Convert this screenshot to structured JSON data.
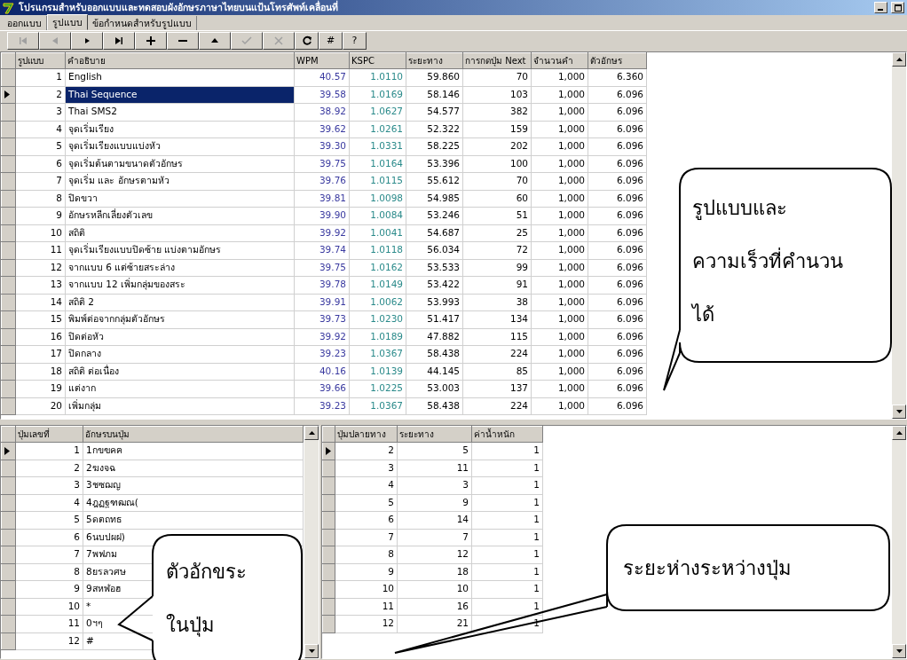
{
  "window": {
    "title": "โปรแกรมสำหรับออกแบบและทดสอบผังอักษรภาษาไทยบนแป้นโทรศัพท์เคลื่อนที่"
  },
  "tabs": [
    {
      "label": "ออกแบบ",
      "selected": false
    },
    {
      "label": "รูปแบบ",
      "selected": true
    },
    {
      "label": "ข้อกำหนดสำหรับรูปแบบ",
      "selected": false
    }
  ],
  "toolbar": [
    {
      "kind": "first",
      "disabled": true
    },
    {
      "kind": "prior",
      "disabled": true
    },
    {
      "kind": "next",
      "disabled": false
    },
    {
      "kind": "last",
      "disabled": false
    },
    {
      "kind": "insert",
      "disabled": false
    },
    {
      "kind": "delete",
      "disabled": false
    },
    {
      "kind": "edit",
      "disabled": false
    },
    {
      "kind": "post",
      "disabled": true
    },
    {
      "kind": "cancel",
      "disabled": true
    },
    {
      "kind": "refresh",
      "disabled": false
    },
    {
      "kind": "text",
      "label": "#",
      "disabled": false
    },
    {
      "kind": "text",
      "label": "?",
      "disabled": false
    }
  ],
  "layouts_table": {
    "columns": [
      "รูปแบบ",
      "คำอธิบาย",
      "WPM",
      "KSPC",
      "ระยะทาง",
      "การกดปุ่ม Next",
      "จำนวนคำ",
      "ตัวอักษร"
    ],
    "rows": [
      {
        "selected": false,
        "cells": [
          "1",
          "English",
          "40.57",
          "1.0110",
          "59.860",
          "70",
          "1,000",
          "6.360"
        ]
      },
      {
        "selected": true,
        "cells": [
          "2",
          "Thai Sequence",
          "39.58",
          "1.0169",
          "58.146",
          "103",
          "1,000",
          "6.096"
        ]
      },
      {
        "selected": false,
        "cells": [
          "3",
          "Thai SMS2",
          "38.92",
          "1.0627",
          "54.577",
          "382",
          "1,000",
          "6.096"
        ]
      },
      {
        "selected": false,
        "cells": [
          "4",
          "จุดเริ่มเรียง",
          "39.62",
          "1.0261",
          "52.322",
          "159",
          "1,000",
          "6.096"
        ]
      },
      {
        "selected": false,
        "cells": [
          "5",
          "จุดเริ่มเรียงแบบแบ่งหัว",
          "39.30",
          "1.0331",
          "58.225",
          "202",
          "1,000",
          "6.096"
        ]
      },
      {
        "selected": false,
        "cells": [
          "6",
          "จุดเริ่มต้นตามขนาดตัวอักษร",
          "39.75",
          "1.0164",
          "53.396",
          "100",
          "1,000",
          "6.096"
        ]
      },
      {
        "selected": false,
        "cells": [
          "7",
          "จุดเริ่ม และ อักษรตามหัว",
          "39.76",
          "1.0115",
          "55.612",
          "70",
          "1,000",
          "6.096"
        ]
      },
      {
        "selected": false,
        "cells": [
          "8",
          "ปิดขวา",
          "39.81",
          "1.0098",
          "54.985",
          "60",
          "1,000",
          "6.096"
        ]
      },
      {
        "selected": false,
        "cells": [
          "9",
          "อักษรหลีกเลี่ยงตัวเลข",
          "39.90",
          "1.0084",
          "53.246",
          "51",
          "1,000",
          "6.096"
        ]
      },
      {
        "selected": false,
        "cells": [
          "10",
          "สถิติ",
          "39.92",
          "1.0041",
          "54.687",
          "25",
          "1,000",
          "6.096"
        ]
      },
      {
        "selected": false,
        "cells": [
          "11",
          "จุดเริ่มเรียงแบบปิดซ้าย แบ่งตามอักษร",
          "39.74",
          "1.0118",
          "56.034",
          "72",
          "1,000",
          "6.096"
        ]
      },
      {
        "selected": false,
        "cells": [
          "12",
          "จากแบบ 6 แต่ซ้ายสระล่าง",
          "39.75",
          "1.0162",
          "53.533",
          "99",
          "1,000",
          "6.096"
        ]
      },
      {
        "selected": false,
        "cells": [
          "13",
          "จากแบบ 12 เพิ่มกลุ่มของสระ",
          "39.78",
          "1.0149",
          "53.422",
          "91",
          "1,000",
          "6.096"
        ]
      },
      {
        "selected": false,
        "cells": [
          "14",
          "สถิติ 2",
          "39.91",
          "1.0062",
          "53.993",
          "38",
          "1,000",
          "6.096"
        ]
      },
      {
        "selected": false,
        "cells": [
          "15",
          "พิมพ์ต่อจากกลุ่มตัวอักษร",
          "39.73",
          "1.0230",
          "51.417",
          "134",
          "1,000",
          "6.096"
        ]
      },
      {
        "selected": false,
        "cells": [
          "16",
          "ปิดต่อหัว",
          "39.92",
          "1.0189",
          "47.882",
          "115",
          "1,000",
          "6.096"
        ]
      },
      {
        "selected": false,
        "cells": [
          "17",
          "ปิดกลาง",
          "39.23",
          "1.0367",
          "58.438",
          "224",
          "1,000",
          "6.096"
        ]
      },
      {
        "selected": false,
        "cells": [
          "18",
          "สถิติ ต่อเนื่อง",
          "40.16",
          "1.0139",
          "44.145",
          "85",
          "1,000",
          "6.096"
        ]
      },
      {
        "selected": false,
        "cells": [
          "19",
          "แต่งาก",
          "39.66",
          "1.0225",
          "53.003",
          "137",
          "1,000",
          "6.096"
        ]
      },
      {
        "selected": false,
        "cells": [
          "20",
          "เพิ่มกลุ่ม",
          "39.23",
          "1.0367",
          "58.438",
          "224",
          "1,000",
          "6.096"
        ]
      }
    ]
  },
  "keys_table": {
    "columns": [
      "ปุ่มเลขที่",
      "อักษรบนปุ่ม"
    ],
    "rows": [
      {
        "selected": true,
        "cells": [
          "1",
          "1กขฃคฅ"
        ]
      },
      {
        "selected": false,
        "cells": [
          "2",
          "2ฆงจฉ"
        ]
      },
      {
        "selected": false,
        "cells": [
          "3",
          "3ชซฌญ"
        ]
      },
      {
        "selected": false,
        "cells": [
          "4",
          "4ฎฏฐฑฒณ("
        ]
      },
      {
        "selected": false,
        "cells": [
          "5",
          "5ดตถทธ"
        ]
      },
      {
        "selected": false,
        "cells": [
          "6",
          "6นบปผฝ)"
        ]
      },
      {
        "selected": false,
        "cells": [
          "7",
          "7พฟภม"
        ]
      },
      {
        "selected": false,
        "cells": [
          "8",
          "8ยรลวศษ"
        ]
      },
      {
        "selected": false,
        "cells": [
          "9",
          "9สหฬอฮ"
        ]
      },
      {
        "selected": false,
        "cells": [
          "10",
          "*"
        ]
      },
      {
        "selected": false,
        "cells": [
          "11",
          "0ฯๆ"
        ]
      },
      {
        "selected": false,
        "cells": [
          "12",
          "#"
        ]
      }
    ]
  },
  "distance_table": {
    "columns": [
      "ปุ่มปลายทาง",
      "ระยะทาง",
      "ค่าน้ำหนัก"
    ],
    "rows": [
      {
        "selected": true,
        "cells": [
          "2",
          "5",
          "1"
        ]
      },
      {
        "selected": false,
        "cells": [
          "3",
          "11",
          "1"
        ]
      },
      {
        "selected": false,
        "cells": [
          "4",
          "3",
          "1"
        ]
      },
      {
        "selected": false,
        "cells": [
          "5",
          "9",
          "1"
        ]
      },
      {
        "selected": false,
        "cells": [
          "6",
          "14",
          "1"
        ]
      },
      {
        "selected": false,
        "cells": [
          "7",
          "7",
          "1"
        ]
      },
      {
        "selected": false,
        "cells": [
          "8",
          "12",
          "1"
        ]
      },
      {
        "selected": false,
        "cells": [
          "9",
          "18",
          "1"
        ]
      },
      {
        "selected": false,
        "cells": [
          "10",
          "10",
          "1"
        ]
      },
      {
        "selected": false,
        "cells": [
          "11",
          "16",
          "1"
        ]
      },
      {
        "selected": false,
        "cells": [
          "12",
          "21",
          "1"
        ]
      }
    ]
  },
  "callouts": [
    {
      "lines": [
        "รูปแบบและ",
        "ความเร็วที่คำนวน",
        "ได้"
      ]
    },
    {
      "lines": [
        "ตัวอักขระ",
        "ในปุ่ม"
      ]
    },
    {
      "lines": [
        "ระยะห่างระหว่างปุ่ม"
      ]
    }
  ]
}
